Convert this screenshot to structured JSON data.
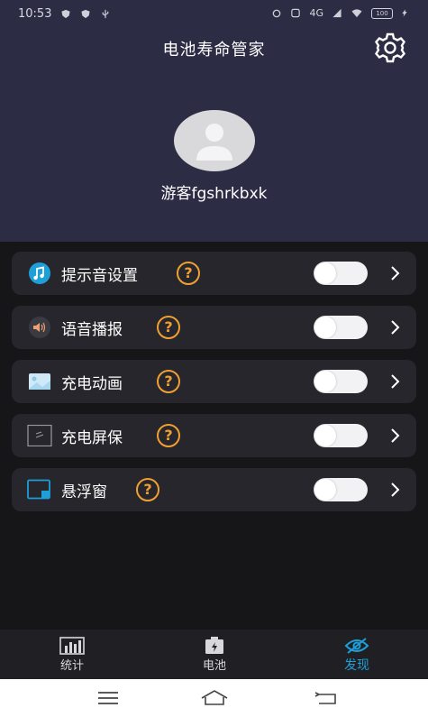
{
  "status_bar": {
    "time": "10:53",
    "battery": "100",
    "net": "4G"
  },
  "header": {
    "title": "电池寿命管家",
    "settings_icon": "gear-icon"
  },
  "profile": {
    "avatar_icon": "user-avatar-icon",
    "username": "游客fgshrkbxk"
  },
  "settings": [
    {
      "label": "提示音设置",
      "icon": "music-note-icon",
      "enabled": false
    },
    {
      "label": "语音播报",
      "icon": "speaker-icon",
      "enabled": false
    },
    {
      "label": "充电动画",
      "icon": "picture-icon",
      "enabled": false
    },
    {
      "label": "充电屏保",
      "icon": "screensaver-icon",
      "enabled": false
    },
    {
      "label": "悬浮窗",
      "icon": "floating-window-icon",
      "enabled": false
    }
  ],
  "help_glyph": "?",
  "tabs": [
    {
      "label": "统计",
      "icon": "bar-chart-icon",
      "active": false
    },
    {
      "label": "电池",
      "icon": "battery-icon",
      "active": false
    },
    {
      "label": "发现",
      "icon": "discover-eye-icon",
      "active": true
    }
  ],
  "colors": {
    "header_bg": "#2c2c44",
    "row_bg": "#26262c",
    "accent": "#1e9fd8",
    "help": "#f0a030"
  }
}
